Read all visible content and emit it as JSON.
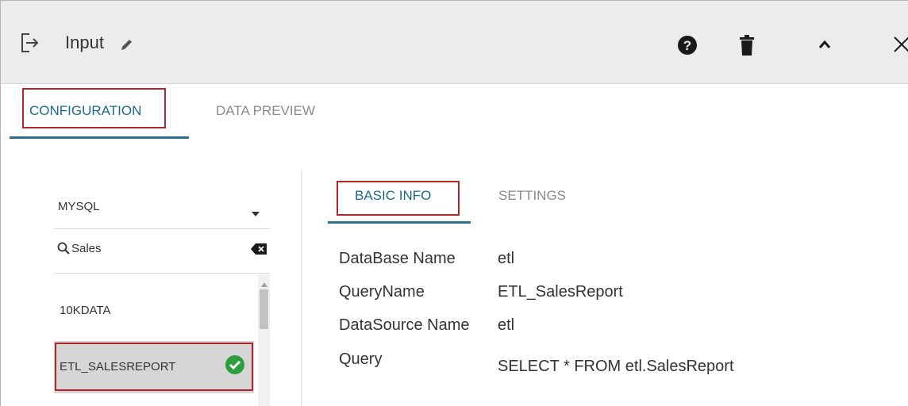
{
  "header": {
    "title": "Input",
    "icons": [
      "input-icon",
      "pencil-icon",
      "help-icon",
      "trash-icon",
      "chevron-up-icon",
      "close-icon"
    ]
  },
  "tabs": [
    {
      "label": "CONFIGURATION",
      "active": true
    },
    {
      "label": "DATA PREVIEW",
      "active": false
    }
  ],
  "left_panel": {
    "database": "MYSQL",
    "search_value": "Sales",
    "items": [
      {
        "label": "10KDATA",
        "selected": false
      },
      {
        "label": "ETL_SALESREPORT",
        "selected": true
      }
    ]
  },
  "right_panel": {
    "tabs": [
      {
        "label": "BASIC INFO",
        "active": true
      },
      {
        "label": "SETTINGS",
        "active": false
      }
    ],
    "fields": [
      {
        "label": "DataBase Name",
        "value": "etl"
      },
      {
        "label": "QueryName",
        "value": "ETL_SalesReport"
      },
      {
        "label": "DataSource Name",
        "value": "etl"
      },
      {
        "label": "Query",
        "value": "SELECT * FROM etl.SalesReport"
      }
    ]
  },
  "colors": {
    "accent": "#1b6a8c",
    "highlight_border": "#b1262d",
    "success": "#2e9e3f",
    "header_bg": "#ececec"
  }
}
